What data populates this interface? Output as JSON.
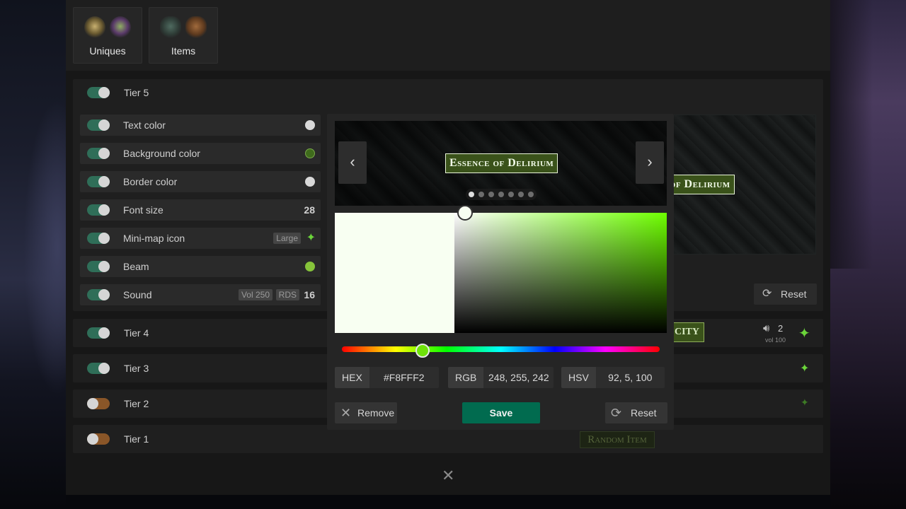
{
  "categories": [
    {
      "label": "Uniques",
      "icons": [
        "amulet-icon",
        "orb-icon"
      ]
    },
    {
      "label": "Items",
      "icons": [
        "helmet-icon",
        "gloves-icon"
      ]
    }
  ],
  "tiers": {
    "tier5": {
      "label": "Tier 5",
      "enabled": true
    },
    "tier4": {
      "label": "Tier 4",
      "enabled": true,
      "sound_count": "2",
      "sound_vol": "vol 100"
    },
    "tier3": {
      "label": "Tier 3",
      "enabled": true
    },
    "tier2": {
      "label": "Tier 2",
      "enabled": false
    },
    "tier1": {
      "label": "Tier 1",
      "enabled": false,
      "preview_text": "Random Item"
    }
  },
  "properties": [
    {
      "label": "Text color",
      "swatch": "#d9d9d9"
    },
    {
      "label": "Background color",
      "swatch": "#3f6b1c"
    },
    {
      "label": "Border color",
      "swatch": "#d9d9d9"
    },
    {
      "label": "Font size",
      "value": "28"
    },
    {
      "label": "Mini-map icon",
      "tag": "Large"
    },
    {
      "label": "Beam",
      "swatch": "#86c33a"
    },
    {
      "label": "Sound",
      "tag1": "Vol 250",
      "tag2": "RDS",
      "value": "16"
    }
  ],
  "preview": {
    "item_name": "Essence of Delirium",
    "tier4_item_partial": "CITY",
    "reset_label": "Reset"
  },
  "color_picker": {
    "current_color": "#F8FFF2",
    "hue_color": "#6EFF00",
    "hex_label": "HEX",
    "hex_value": "#F8FFF2",
    "rgb_label": "RGB",
    "rgb_value": "248, 255, 242",
    "hsv_label": "HSV",
    "hsv_value": "92, 5, 100",
    "remove_label": "Remove",
    "save_label": "Save",
    "reset_label": "Reset",
    "carousel_pages": 7,
    "carousel_active": 0
  },
  "colors": {
    "accent_green": "#016b4f",
    "toggle_on": "#2f6e58",
    "toggle_off": "#8a5628"
  }
}
